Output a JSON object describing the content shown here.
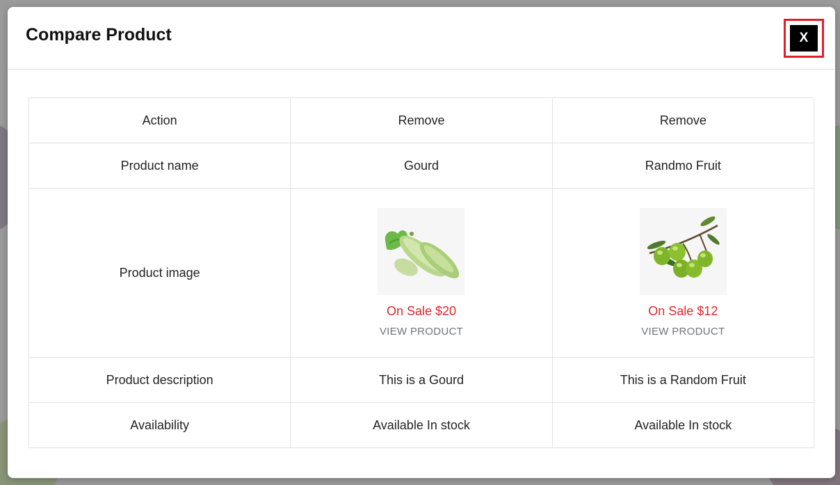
{
  "modal": {
    "title": "Compare Product",
    "close_label": "X"
  },
  "table": {
    "labels": {
      "action": "Action",
      "name": "Product name",
      "image": "Product image",
      "description": "Product description",
      "availability": "Availability"
    },
    "products": [
      {
        "action": "Remove",
        "name": "Gourd",
        "image_icon": "gourd-icon",
        "price": "On Sale $20",
        "view": "VIEW PRODUCT",
        "description": "This is a Gourd",
        "availability": "Available In stock"
      },
      {
        "action": "Remove",
        "name": "Randmo Fruit",
        "image_icon": "olive-icon",
        "price": "On Sale $12",
        "view": "VIEW PRODUCT",
        "description": "This is a Random Fruit",
        "availability": "Available In stock"
      }
    ]
  },
  "colors": {
    "sale": "#e0262b",
    "close_outline": "#e11d2a",
    "close_bg": "#000000"
  }
}
